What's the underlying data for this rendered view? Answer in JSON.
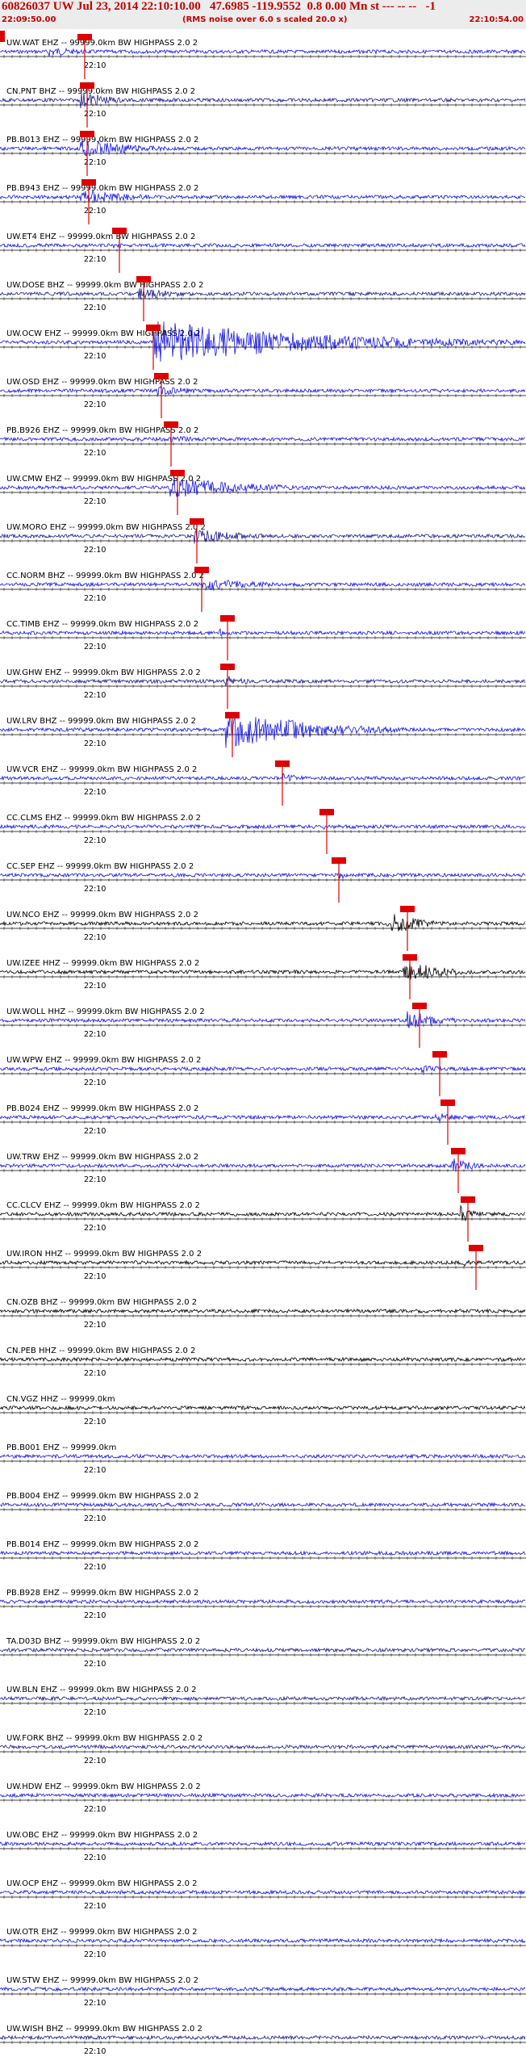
{
  "header": {
    "title": "60826037 UW Jul 23, 2014 22:10:10.00   47.6985 -119.9552  0.8 0.00 Mn st --- -- --   -1",
    "start_time": "22:09:50.00",
    "note": "(RMS noise over 6.0 s scaled 20.0 x)",
    "end_time": "22:10:54.00"
  },
  "time_label": "22:10",
  "colors": {
    "trace_blue": "#1414e6",
    "trace_black": "#000000",
    "pick_red": "#dd0000",
    "header_red": "#c00000"
  },
  "traces": [
    {
      "label": "UW.WAT EHZ -- 99999.0km BW  HIGHPASS  2.0  2",
      "color": "blue"
    },
    {
      "label": "CN.PNT BHZ -- 99999.0km BW  HIGHPASS  2.0  2",
      "color": "navy"
    },
    {
      "label": "PB.B013 EHZ -- 99999.0km BW  HIGHPASS  2.0  2",
      "color": "blue"
    },
    {
      "label": "PB.B943 EHZ -- 99999.0km BW  HIGHPASS  2.0  2",
      "color": "blue"
    },
    {
      "label": "UW.ET4 EHZ -- 99999.0km BW  HIGHPASS  2.0  2",
      "color": "blue"
    },
    {
      "label": "UW.DOSE BHZ -- 99999.0km BW  HIGHPASS  2.0  2",
      "color": "navy"
    },
    {
      "label": "UW.OCW EHZ -- 99999.0km BW  HIGHPASS  2.0  2",
      "color": "blue"
    },
    {
      "label": "UW.OSD EHZ -- 99999.0km BW  HIGHPASS  2.0  2",
      "color": "blue"
    },
    {
      "label": "PB.B926 EHZ -- 99999.0km BW  HIGHPASS  2.0  2",
      "color": "blue"
    },
    {
      "label": "UW.CMW EHZ -- 99999.0km BW  HIGHPASS  2.0  2",
      "color": "blue"
    },
    {
      "label": "UW.MORO EHZ -- 99999.0km BW  HIGHPASS  2.0  2",
      "color": "navy"
    },
    {
      "label": "CC.NORM BHZ -- 99999.0km BW  HIGHPASS  2.0  2",
      "color": "blue"
    },
    {
      "label": "CC.TIMB EHZ -- 99999.0km BW  HIGHPASS  2.0  2",
      "color": "blue"
    },
    {
      "label": "UW.GHW EHZ -- 99999.0km BW  HIGHPASS  2.0  2",
      "color": "navy"
    },
    {
      "label": "UW.LRV BHZ -- 99999.0km BW  HIGHPASS  2.0  2",
      "color": "blue"
    },
    {
      "label": "UW.VCR EHZ -- 99999.0km BW  HIGHPASS  2.0  2",
      "color": "blue"
    },
    {
      "label": "CC.CLMS EHZ -- 99999.0km BW  HIGHPASS  2.0  2",
      "color": "blue"
    },
    {
      "label": "CC.SEP EHZ -- 99999.0km BW  HIGHPASS  2.0  2",
      "color": "blue"
    },
    {
      "label": "UW.NCO EHZ -- 99999.0km BW  HIGHPASS  2.0  2",
      "color": "black"
    },
    {
      "label": "UW.IZEE HHZ -- 99999.0km BW  HIGHPASS  2.0  2",
      "color": "black"
    },
    {
      "label": "UW.WOLL HHZ -- 99999.0km BW  HIGHPASS  2.0  2",
      "color": "blue"
    },
    {
      "label": "UW.WPW EHZ -- 99999.0km BW  HIGHPASS  2.0  2",
      "color": "blue"
    },
    {
      "label": "PB.B024 EHZ -- 99999.0km BW  HIGHPASS  2.0  2",
      "color": "blue"
    },
    {
      "label": "UW.TRW EHZ -- 99999.0km BW  HIGHPASS  2.0  2",
      "color": "blue"
    },
    {
      "label": "CC.CLCV EHZ -- 99999.0km BW  HIGHPASS  2.0  2",
      "color": "black"
    },
    {
      "label": "UW.IRON HHZ -- 99999.0km BW  HIGHPASS  2.0  2",
      "color": "black"
    },
    {
      "label": "CN.OZB BHZ -- 99999.0km BW  HIGHPASS  2.0  2",
      "color": "black"
    },
    {
      "label": "CN.PEB HHZ -- 99999.0km BW  HIGHPASS  2.0  2",
      "color": "black"
    },
    {
      "label": "CN.VGZ HHZ -- 99999.0km",
      "color": "black"
    },
    {
      "label": "PB.B001 EHZ -- 99999.0km",
      "color": "blue"
    },
    {
      "label": "PB.B004 EHZ -- 99999.0km BW  HIGHPASS  2.0  2",
      "color": "blue"
    },
    {
      "label": "PB.B014 EHZ -- 99999.0km BW  HIGHPASS  2.0  2",
      "color": "blue"
    },
    {
      "label": "PB.B928 EHZ -- 99999.0km BW  HIGHPASS  2.0  2",
      "color": "blue"
    },
    {
      "label": "TA.D03D BHZ -- 99999.0km BW  HIGHPASS  2.0  2",
      "color": "navy"
    },
    {
      "label": "UW.BLN EHZ -- 99999.0km BW  HIGHPASS  2.0  2",
      "color": "navy"
    },
    {
      "label": "UW.FORK BHZ -- 99999.0km BW  HIGHPASS  2.0  2",
      "color": "navy"
    },
    {
      "label": "UW.HDW EHZ -- 99999.0km BW  HIGHPASS  2.0  2",
      "color": "blue"
    },
    {
      "label": "UW.OBC EHZ -- 99999.0km BW  HIGHPASS  2.0  2",
      "color": "blue"
    },
    {
      "label": "UW.OCP EHZ -- 99999.0km BW  HIGHPASS  2.0  2",
      "color": "blue"
    },
    {
      "label": "UW.OTR EHZ -- 99999.0km BW  HIGHPASS  2.0  2",
      "color": "blue"
    },
    {
      "label": "UW.STW EHZ -- 99999.0km BW  HIGHPASS  2.0  2",
      "color": "blue"
    },
    {
      "label": "UW.WISH BHZ -- 99999.0km BW  HIGHPASS  2.0  2",
      "color": "navy"
    }
  ]
}
